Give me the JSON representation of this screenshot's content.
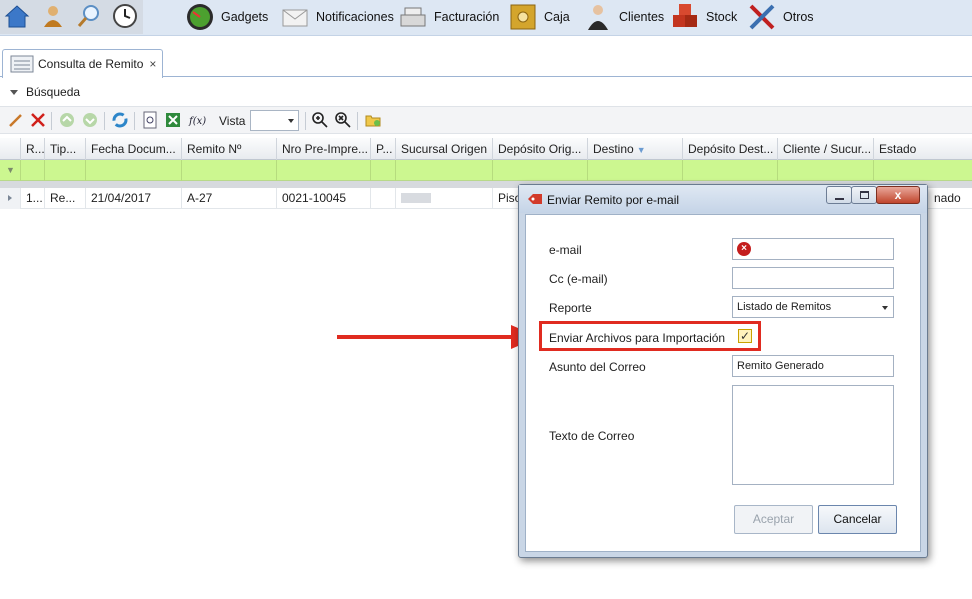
{
  "menu": {
    "items": [
      {
        "label": "Gadgets",
        "icon": "gauge-icon"
      },
      {
        "label": "Notificaciones",
        "icon": "envelope-icon"
      },
      {
        "label": "Facturación",
        "icon": "cash-register-icon"
      },
      {
        "label": "Caja",
        "icon": "safe-icon"
      },
      {
        "label": "Clientes",
        "icon": "person-icon"
      },
      {
        "label": "Stock",
        "icon": "boxes-icon"
      },
      {
        "label": "Otros",
        "icon": "tools-icon"
      }
    ]
  },
  "tab": {
    "label": "Consulta de Remito",
    "close": "×"
  },
  "search_panel": {
    "label": "Búsqueda"
  },
  "toolbar": {
    "vista_label": "Vista",
    "vista_value": ""
  },
  "grid": {
    "columns": [
      "R...",
      "Tip...",
      "Fecha Docum...",
      "Remito Nº",
      "Nro Pre-Impre...",
      "P...",
      "Sucursal Origen",
      "Depósito Orig...",
      "Destino",
      "Depósito Dest...",
      "Cliente / Sucur...",
      "Estado"
    ],
    "row": [
      "1...",
      "Re...",
      "21/04/2017",
      "A-27",
      "0021-10045",
      "",
      "",
      "Piso",
      "",
      "",
      "",
      "nado"
    ]
  },
  "dialog": {
    "title": "Enviar Remito por e-mail",
    "email_label": "e-mail",
    "email_value": "",
    "cc_label": "Cc (e-mail)",
    "cc_value": "",
    "reporte_label": "Reporte",
    "reporte_value": "Listado de Remitos",
    "enviar_label": "Enviar Archivos para Importación",
    "enviar_checked": true,
    "asunto_label": "Asunto del Correo",
    "asunto_value": "Remito Generado",
    "texto_label": "Texto de Correo",
    "texto_value": "",
    "accept": "Aceptar",
    "cancel": "Cancelar",
    "win_close": "x"
  },
  "colors": {
    "highlight": "#e02b20",
    "filter_row": "#ccf790"
  }
}
